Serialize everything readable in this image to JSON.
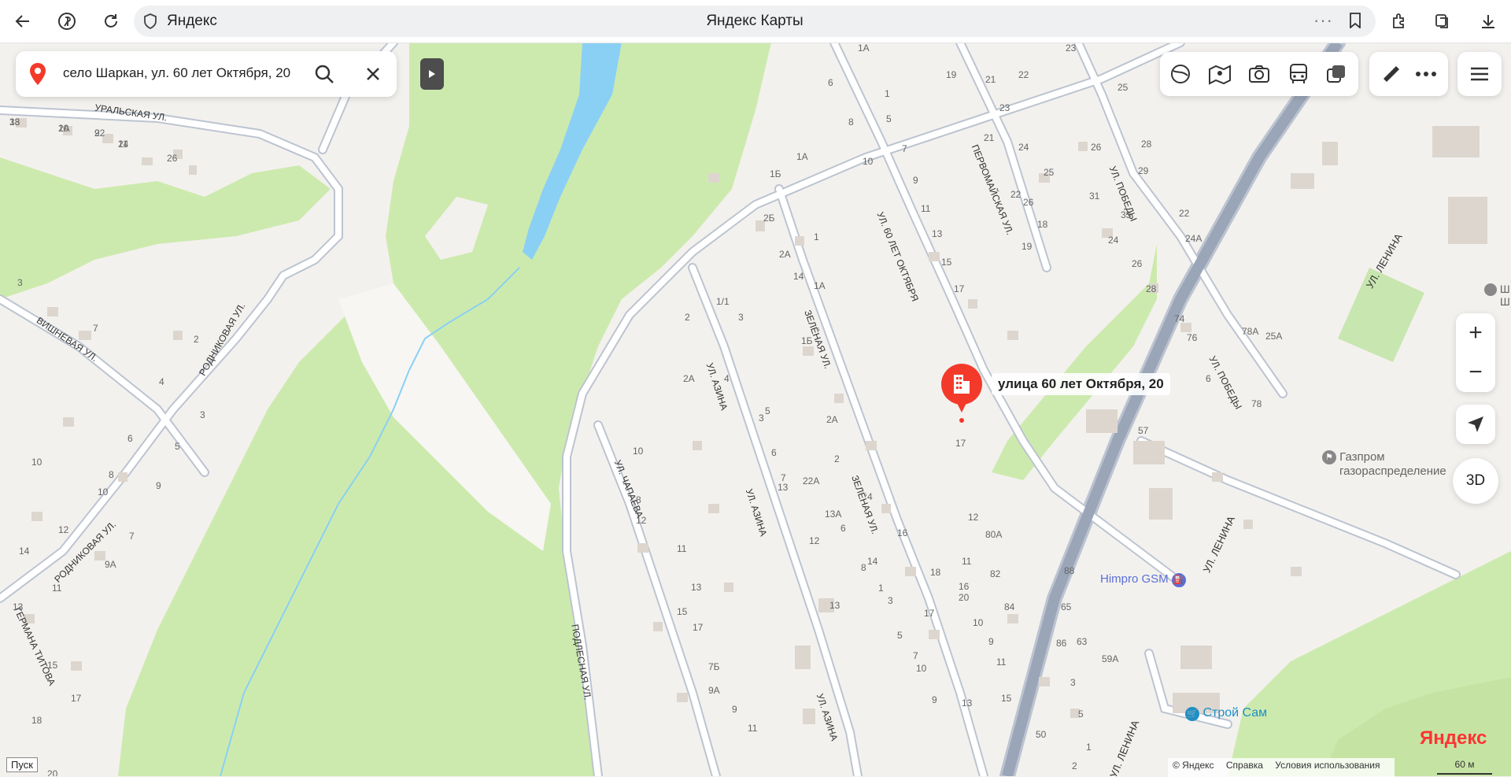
{
  "browser": {
    "site": "Яндекс",
    "page_title": "Яндекс Карты"
  },
  "search": {
    "query": "село Шаркан, ул. 60 лет Октября, 20"
  },
  "marker": {
    "label": "улица 60 лет Октября, 20"
  },
  "pois": [
    {
      "name": "Газпром",
      "name2": "газораспределение"
    },
    {
      "name": "Himpro GSM"
    },
    {
      "name": "Строй Сам"
    },
    {
      "name": "Ш",
      "name2": "Ш"
    }
  ],
  "streets": {
    "uralskaya": "УРАЛЬСКАЯ УЛ.",
    "vishnevaya": "ВИШНЕВАЯ УЛ.",
    "rodnikovaya": "РОДНИКОВАЯ УЛ.",
    "chapaeva": "УЛ. ЧАПАЕВА",
    "podlesnaya": "ПОДЛЕСНАЯ УЛ.",
    "azina": "УЛ. АЗИНА",
    "zelenaya": "ЗЕЛЁНАЯ УЛ.",
    "oktyabrya": "УЛ. 60 ЛЕТ ОКТЯБРЯ",
    "pervomayskaya": "ПЕРВОМАЙСКАЯ УЛ.",
    "pobedy": "УЛ. ПОБЕДЫ",
    "lenina": "УЛ. ЛЕНИНА",
    "titova": "ГЕРМАНА ТИТОВА"
  },
  "house_numbers": [
    "18",
    "20",
    "22",
    "24",
    "26",
    "3",
    "7",
    "2",
    "4",
    "3",
    "6",
    "5",
    "8",
    "10",
    "9",
    "12",
    "7",
    "14",
    "11",
    "9А",
    "13",
    "15",
    "17",
    "18",
    "20",
    "10",
    "1А",
    "6",
    "1",
    "8",
    "5",
    "10",
    "7",
    "9",
    "11",
    "13",
    "15",
    "17",
    "1А",
    "1Б",
    "2Б",
    "2А",
    "1",
    "1/1",
    "2",
    "3",
    "2А",
    "4",
    "5",
    "3",
    "6",
    "7",
    "8",
    "10",
    "12",
    "14",
    "1А",
    "1Б",
    "2А",
    "2",
    "4",
    "6",
    "8",
    "1",
    "3",
    "5",
    "7",
    "10",
    "9",
    "11",
    "13",
    "15",
    "17",
    "7Б",
    "9А",
    "9",
    "11",
    "13",
    "22А",
    "12",
    "13А",
    "13",
    "14",
    "16",
    "18",
    "20",
    "10",
    "9",
    "11",
    "13",
    "15",
    "17",
    "12",
    "11",
    "16",
    "17",
    "19",
    "21",
    "22",
    "23",
    "24",
    "25",
    "26",
    "18",
    "19",
    "21",
    "22",
    "23",
    "25",
    "26",
    "28",
    "29",
    "31",
    "33",
    "24",
    "22",
    "24А",
    "26",
    "28",
    "74",
    "76",
    "78А",
    "25А",
    "78",
    "80А",
    "82",
    "84",
    "86",
    "88",
    "65",
    "63",
    "59А",
    "3",
    "5",
    "2",
    "6",
    "1",
    "57",
    "50",
    "33",
    "1А",
    "9",
    "11"
  ],
  "map_controls": {
    "zoom_in": "+",
    "zoom_out": "−",
    "btn_3d": "3D"
  },
  "attribution": {
    "copyright": "© Яндекс",
    "help": "Справка",
    "terms": "Условия использования",
    "scale": "60 м",
    "logo": "Яндекс"
  },
  "taskbar": {
    "start": "Пуск"
  },
  "colors": {
    "forest": "#cdeaae",
    "water": "#8ad0f5",
    "road": "#ffffff",
    "road_outline": "#bcc4d0",
    "marker": "#f33a2a",
    "poi_blue": "#5a6fd6",
    "poi_teal": "#1f8fc6"
  }
}
